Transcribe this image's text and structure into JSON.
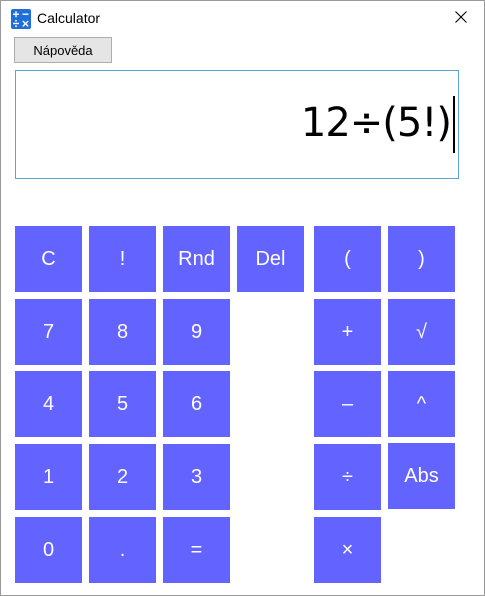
{
  "window": {
    "title": "Calculator"
  },
  "toolbar": {
    "help_label": "Nápověda"
  },
  "display": {
    "expression": "12÷(5!)"
  },
  "keys": {
    "clear": "C",
    "factorial": "!",
    "random": "Rnd",
    "delete": "Del",
    "lparen": "(",
    "rparen": ")",
    "d7": "7",
    "d8": "8",
    "d9": "9",
    "plus": "+",
    "sqrt": "√",
    "d4": "4",
    "d5": "5",
    "d6": "6",
    "minus": "–",
    "power": "^",
    "d1": "1",
    "d2": "2",
    "d3": "3",
    "divide": "÷",
    "abs": "Abs",
    "d0": "0",
    "decimal": ".",
    "equals": "=",
    "multiply": "×"
  },
  "colors": {
    "key_bg": "#6363ff",
    "key_text": "#ffffff",
    "display_border": "#5aa5d6"
  }
}
